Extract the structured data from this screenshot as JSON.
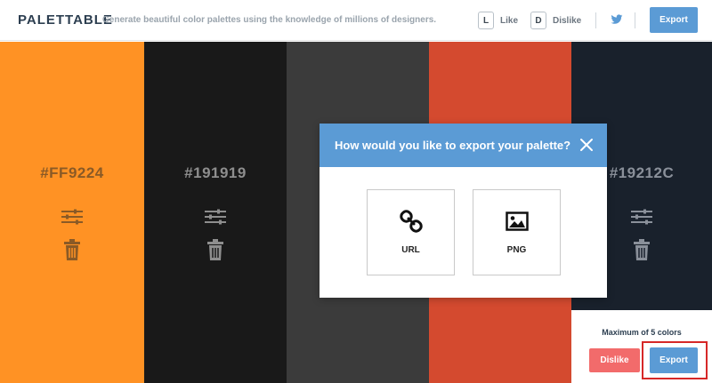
{
  "header": {
    "brand": "PALETTABLE",
    "tagline": "Generate beautiful color palettes using the knowledge of millions of designers.",
    "like": {
      "key": "L",
      "label": "Like"
    },
    "dislike": {
      "key": "D",
      "label": "Dislike"
    },
    "twitter_icon": "twitter-icon",
    "export_label": "Export"
  },
  "palette": [
    {
      "hex": "#FF9224",
      "background": "#FF9224",
      "text_color": "#8a5a26",
      "icon_color": "#8a5a26"
    },
    {
      "hex": "#191919",
      "background": "#191919",
      "text_color": "#8e8e8e",
      "icon_color": "#8e8e8e"
    },
    {
      "hex": "",
      "background": "#3b3b3b",
      "text_color": "#9a9a9a",
      "icon_color": "#9a9a9a"
    },
    {
      "hex": "",
      "background": "#D44A2F",
      "text_color": "#f0b0a0",
      "icon_color": "#f0b0a0"
    },
    {
      "hex": "#19212C",
      "background": "#19212C",
      "text_color": "#8a909a",
      "icon_color": "#8a909a"
    }
  ],
  "panel": {
    "max_text": "Maximum of 5 colors",
    "dislike_label": "Dislike",
    "export_label": "Export"
  },
  "modal": {
    "title": "How would you like to export your palette?",
    "options": [
      {
        "label": "URL",
        "icon": "link-icon"
      },
      {
        "label": "PNG",
        "icon": "image-icon"
      }
    ]
  },
  "colors": {
    "accent": "#5b9bd5",
    "danger": "#f26b6b",
    "highlight": "#d62828"
  }
}
